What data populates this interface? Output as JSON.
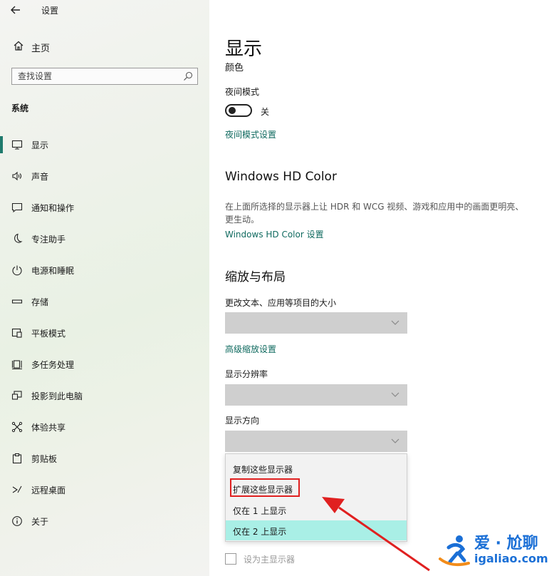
{
  "window": {
    "title": "设置"
  },
  "sidebar": {
    "home_label": "主页",
    "search_placeholder": "查找设置",
    "section_title": "系统",
    "items": [
      {
        "label": "显示",
        "icon": "monitor-icon",
        "active": true
      },
      {
        "label": "声音",
        "icon": "speaker-icon"
      },
      {
        "label": "通知和操作",
        "icon": "message-icon"
      },
      {
        "label": "专注助手",
        "icon": "moon-icon"
      },
      {
        "label": "电源和睡眠",
        "icon": "power-icon"
      },
      {
        "label": "存储",
        "icon": "storage-icon"
      },
      {
        "label": "平板模式",
        "icon": "tablet-icon"
      },
      {
        "label": "多任务处理",
        "icon": "multitask-icon"
      },
      {
        "label": "投影到此电脑",
        "icon": "project-icon"
      },
      {
        "label": "体验共享",
        "icon": "share-icon"
      },
      {
        "label": "剪贴板",
        "icon": "clipboard-icon"
      },
      {
        "label": "远程桌面",
        "icon": "remote-icon"
      },
      {
        "label": "关于",
        "icon": "info-icon"
      }
    ]
  },
  "main": {
    "page_title": "显示",
    "color_heading": "颜色",
    "night_mode_label": "夜间模式",
    "night_mode_state": "关",
    "night_mode_link": "夜间模式设置",
    "hdr_heading": "Windows HD Color",
    "hdr_desc": "在上面所选择的显示器上让 HDR 和 WCG 视频、游戏和应用中的画面更明亮、更生动。",
    "hdr_link": "Windows HD Color 设置",
    "scale_heading": "缩放与布局",
    "text_size_label": "更改文本、应用等项目的大小",
    "advanced_scaling_link": "高级缩放设置",
    "resolution_label": "显示分辨率",
    "orientation_label": "显示方向",
    "dropdown_options": [
      "复制这些显示器",
      "扩展这些显示器",
      "仅在 1 上显示",
      "仅在 2 上显示"
    ],
    "dropdown_selected_index": 3,
    "highlighted_option_index": 1,
    "primary_checkbox_label": "设为主显示器"
  },
  "watermark": {
    "line1": "爱 · 尬聊",
    "line2": "igaliao.com"
  },
  "colors": {
    "accent": "#0f6a5f",
    "selected": "#a9efe6",
    "highlight_border": "#e02020",
    "arrow": "#e02020",
    "watermark": "#1a6fd6"
  }
}
